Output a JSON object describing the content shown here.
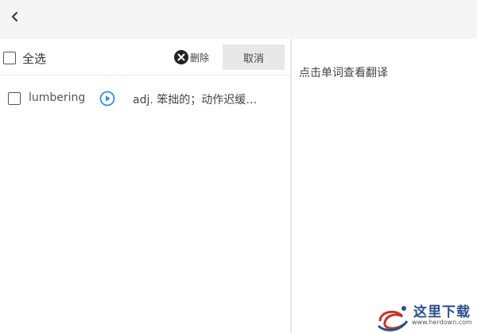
{
  "topbar": {
    "back_icon": "chevron-left-icon"
  },
  "toolbar": {
    "select_all_label": "全选",
    "delete_label": "删除",
    "cancel_label": "取消"
  },
  "words": [
    {
      "word": "lumbering",
      "definition": "adj. 笨拙的；动作迟缓…",
      "checked": false
    }
  ],
  "detail": {
    "hint": "点击单词查看翻译"
  },
  "watermark": {
    "text": "这里下载",
    "url": "www.herdown.com"
  },
  "colors": {
    "accent": "#2f8fe0",
    "topbar_bg": "#f5f5f5",
    "cancel_bg": "#e8e8e8"
  }
}
